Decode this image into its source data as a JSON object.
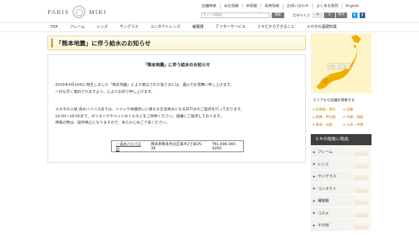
{
  "header": {
    "logo_left": "PARIS",
    "logo_right": "MIKI",
    "util_nav": [
      "店舗検索",
      "会社情報",
      "IR情報",
      "採用情報",
      "お問い合わせ",
      "よくある質問",
      "English"
    ],
    "search": {
      "label": "サイト内検索",
      "button": "検索"
    },
    "font_size": {
      "label": "文字サイズ",
      "mid": "中",
      "big": "大",
      "huge": "特大"
    },
    "sns": {
      "twitter": "t",
      "facebook": "f"
    }
  },
  "global_nav": [
    "TOP",
    "フレーム",
    "レンズ",
    "サングラス",
    "コンタクトレンズ",
    "補聴器",
    "アフターサービス",
    "ミキだからできること",
    "メガネの基礎知識"
  ],
  "main": {
    "page_title": "「熊本地震」に伴う給水のお知らせ",
    "heading": "「熊本地震」に伴う給水のお知らせ",
    "para1": [
      "2016年4月14日に発生しました「熊本地震」により被災された皆さまには、謹んでお見舞い申し上げます。",
      "一日も早く復旧されますよう、心よりお祈り申し上げます。"
    ],
    "para2": [
      "メガネの三城 清水バイパス店では、トイレや食器洗いに使える生活用水になる井戸水のご提供を行っております。",
      "10:00～18:00まで、ポリタンクやペットボトルなどをご持参ください。順番にご提供しております。",
      "停電の際は、提供停止になりますので、あらかじめご了承ください。"
    ],
    "store": {
      "name": "・清水バイパス店",
      "address": "熊本県熊本市北区高平2丁目25-39",
      "tel": "TEL:096-343-6255"
    }
  },
  "sidebar": {
    "map_banner": "店舗検索",
    "region_title": "エリアから店舗を検索する",
    "regions": [
      [
        "北海道・東北",
        "近畿"
      ],
      [
        "関東・甲信越",
        "中国・四国"
      ],
      [
        "東海・北陸",
        "九州・沖縄"
      ]
    ],
    "products_title": "ミキの取扱い商品",
    "products": [
      "フレーム",
      "レンズ",
      "サングラス",
      "コンタクト",
      "補聴器",
      "コスメ",
      "その他"
    ]
  },
  "colors": {
    "accent": "#c9a94a",
    "title_bg": "#fdf6d3",
    "region_link": "#c47a00",
    "products_header": "#3f3f3f"
  }
}
